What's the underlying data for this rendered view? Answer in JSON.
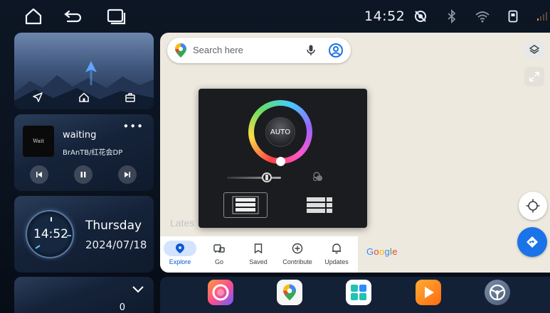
{
  "status_bar": {
    "time": "14:52",
    "icons": [
      "home-icon",
      "back-icon",
      "recents-icon",
      "location-off-icon",
      "bluetooth-icon",
      "wifi-icon",
      "sim-icon",
      "signal-icon"
    ]
  },
  "navigation_card": {
    "shortcuts": [
      "navigate-icon",
      "home-icon",
      "work-icon"
    ]
  },
  "music_card": {
    "track_title": "waiting",
    "artist": "BrAnTB/红花会DP",
    "album_text": "Wait",
    "controls": [
      "previous",
      "pause",
      "next"
    ]
  },
  "clock_card": {
    "time": "14:52",
    "weekday": "Thursday",
    "date": "2024/07/18"
  },
  "bottom_card": {
    "value": "0"
  },
  "map": {
    "search_placeholder": "Search here",
    "latest_label": "Lates",
    "brand": "Google",
    "tabs": [
      {
        "label": "Explore",
        "icon": "pin-icon",
        "active": true
      },
      {
        "label": "Go",
        "icon": "commute-icon",
        "active": false
      },
      {
        "label": "Saved",
        "icon": "bookmark-icon",
        "active": false
      },
      {
        "label": "Contribute",
        "icon": "add-circle-icon",
        "active": false
      },
      {
        "label": "Updates",
        "icon": "bell-icon",
        "active": false
      }
    ]
  },
  "brightness_panel": {
    "auto_label": "AUTO",
    "brightness_level": 0.7,
    "selected_mode": "mode-1"
  },
  "dock": {
    "apps": [
      "colors-app",
      "maps-app",
      "apps-grid-app",
      "video-player-app",
      "steering-wheel-app"
    ]
  },
  "colors": {
    "map_bg": "#ede9df",
    "accent_blue": "#1a73e8",
    "active_tab_pill": "#d3e3fd"
  }
}
